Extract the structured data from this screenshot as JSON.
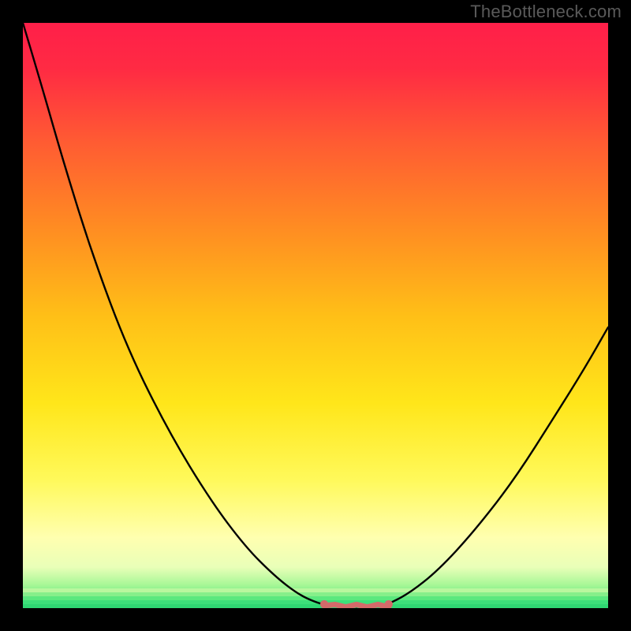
{
  "watermark": "TheBottleneck.com",
  "colors": {
    "background": "#000000",
    "curve": "#000000",
    "valley_marker": "#d46a6a",
    "bottom_band": "#3de07a",
    "gradient_stops": [
      {
        "offset": 0.0,
        "color": "#ff1f49"
      },
      {
        "offset": 0.08,
        "color": "#ff2b43"
      },
      {
        "offset": 0.2,
        "color": "#ff5a33"
      },
      {
        "offset": 0.35,
        "color": "#ff8c22"
      },
      {
        "offset": 0.5,
        "color": "#ffbf17"
      },
      {
        "offset": 0.65,
        "color": "#ffe61a"
      },
      {
        "offset": 0.78,
        "color": "#fff95a"
      },
      {
        "offset": 0.88,
        "color": "#ffffb0"
      },
      {
        "offset": 0.93,
        "color": "#e9ffb8"
      },
      {
        "offset": 0.96,
        "color": "#a8f797"
      },
      {
        "offset": 0.985,
        "color": "#5be87e"
      },
      {
        "offset": 1.0,
        "color": "#2fd773"
      }
    ]
  },
  "chart_data": {
    "type": "line",
    "title": "",
    "xlabel": "",
    "ylabel": "",
    "xlim": [
      0,
      100
    ],
    "ylim": [
      0,
      100
    ],
    "legend": false,
    "grid": false,
    "series": [
      {
        "name": "left-branch",
        "x": [
          0.0,
          3.0,
          7.0,
          12.0,
          18.0,
          25.0,
          32.0,
          38.0,
          43.0,
          47.0,
          50.0,
          52.0
        ],
        "y": [
          100.0,
          90.0,
          76.0,
          60.0,
          44.0,
          30.0,
          18.5,
          10.5,
          5.5,
          2.4,
          1.0,
          0.5
        ]
      },
      {
        "name": "valley",
        "x": [
          52.0,
          54.0,
          56.0,
          58.0,
          60.0,
          62.0
        ],
        "y": [
          0.5,
          0.3,
          0.25,
          0.25,
          0.3,
          0.5
        ]
      },
      {
        "name": "right-branch",
        "x": [
          62.0,
          66.0,
          71.0,
          77.0,
          84.0,
          91.0,
          96.0,
          100.0
        ],
        "y": [
          0.5,
          2.5,
          6.5,
          13.0,
          22.0,
          33.0,
          41.0,
          48.0
        ]
      }
    ],
    "valley_marker": {
      "x_range": [
        51.5,
        62.5
      ],
      "y": 0.4
    }
  }
}
